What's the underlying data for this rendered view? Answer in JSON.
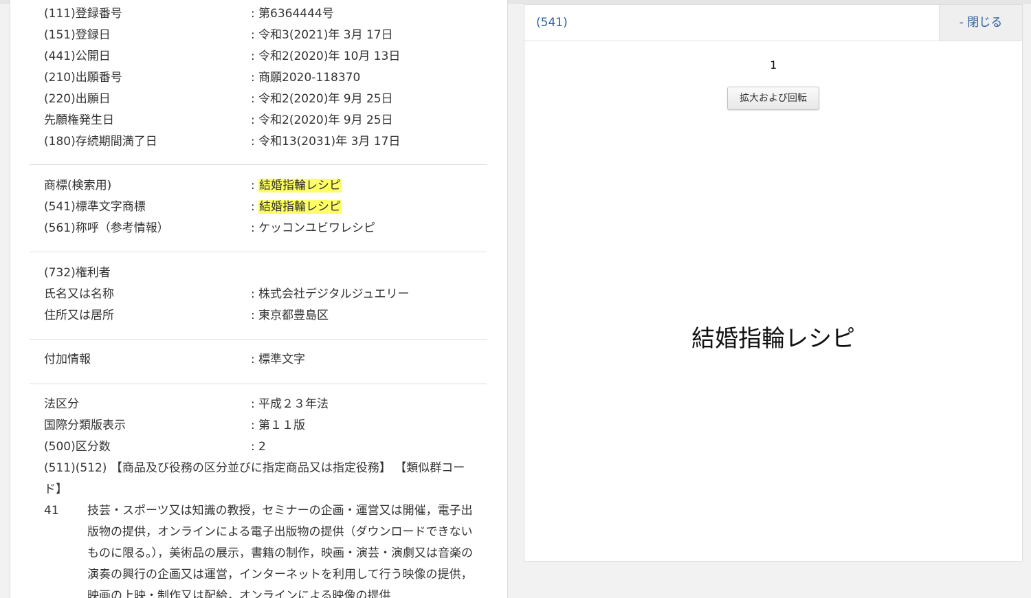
{
  "basic": [
    {
      "label": "(111)登録番号",
      "colon": ":",
      "value": "第6364444号"
    },
    {
      "label": "(151)登録日",
      "colon": ":",
      "value": "令和3(2021)年 3月 17日"
    },
    {
      "label": "(441)公開日",
      "colon": ":",
      "value": "令和2(2020)年 10月 13日"
    },
    {
      "label": "(210)出願番号",
      "colon": ":",
      "value": "商願2020-118370"
    },
    {
      "label": "(220)出願日",
      "colon": ":",
      "value": "令和2(2020)年 9月 25日"
    },
    {
      "label": "先願権発生日",
      "colon": ":",
      "value": "令和2(2020)年 9月 25日"
    },
    {
      "label": "(180)存続期間満了日",
      "colon": ":",
      "value": "令和13(2031)年 3月 17日"
    }
  ],
  "trademark": [
    {
      "label": "商標(検索用)",
      "colon": ":",
      "value": "結婚指輪レシピ"
    },
    {
      "label": "(541)標準文字商標",
      "colon": ":",
      "value": "結婚指輪レシピ"
    },
    {
      "label": "(561)称呼（参考情報）",
      "colon": ":",
      "value": "ケッコンユビワレシピ"
    }
  ],
  "owner": {
    "heading": "(732)権利者",
    "rows": [
      {
        "label": "氏名又は名称",
        "colon": ":",
        "value": "株式会社デジタルジュエリー"
      },
      {
        "label": "住所又は居所",
        "colon": ":",
        "value": "東京都豊島区"
      }
    ]
  },
  "additional": {
    "label": "付加情報",
    "colon": ":",
    "value": "標準文字"
  },
  "legal": [
    {
      "label": "法区分",
      "colon": ":",
      "value": "平成２３年法"
    },
    {
      "label": "国際分類版表示",
      "colon": ":",
      "value": "第１１版"
    },
    {
      "label": "(500)区分数",
      "colon": ":",
      "value": "2"
    }
  ],
  "classification_header": "(511)(512) 【商品及び役務の区分並びに指定商品又は指定役務】 【類似群コード】",
  "goods": {
    "number": "41",
    "description": "技芸・スポーツ又は知識の教授，セミナーの企画・運営又は開催，電子出版物の提供，オンラインによる電子出版物の提供（ダウンロードできないものに限る。），美術品の展示，書籍の制作，映画・演芸・演劇又は音楽の演奏の興行の企画又は運営，インターネットを利用して行う映像の提供，映画の上映・制作又は配給，オンラインによる映像の提供"
  },
  "viewer": {
    "title": "(541)",
    "close_label": "- 閉じる",
    "page_number": "1",
    "zoom_label": "拡大および回転",
    "mark_text": "結婚指輪レシピ"
  }
}
